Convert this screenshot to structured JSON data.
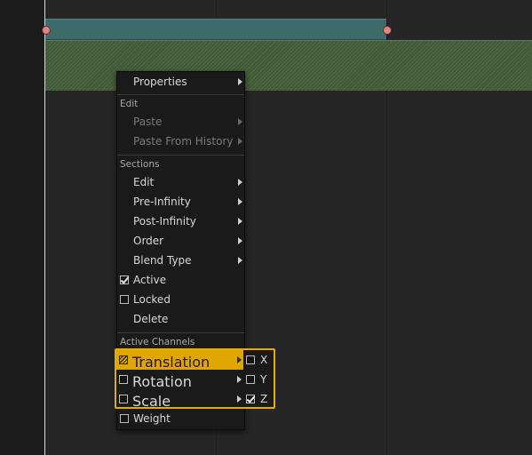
{
  "context_menu": {
    "properties_label": "Properties",
    "edit_header": "Edit",
    "paste_label": "Paste",
    "paste_history_label": "Paste From History",
    "sections_header": "Sections",
    "sections_items": [
      {
        "label": "Edit"
      },
      {
        "label": "Pre-Infinity"
      },
      {
        "label": "Post-Infinity"
      },
      {
        "label": "Order"
      },
      {
        "label": "Blend Type"
      }
    ],
    "active_label": "Active",
    "active_checked": true,
    "locked_label": "Locked",
    "locked_checked": false,
    "delete_label": "Delete",
    "channels_header": "Active Channels",
    "channels": [
      {
        "label": "Translation",
        "state": "partial",
        "selected": true
      },
      {
        "label": "Rotation",
        "state": "unchecked"
      },
      {
        "label": "Scale",
        "state": "unchecked"
      }
    ],
    "weight_label": "Weight",
    "weight_checked": false
  },
  "submenu": {
    "axes": [
      {
        "label": "X",
        "checked": false
      },
      {
        "label": "Y",
        "checked": false
      },
      {
        "label": "Z",
        "checked": true
      }
    ]
  },
  "colors": {
    "highlight": "#e0a500",
    "track_bar": "#3d6a6a",
    "hatch": "#4d6a43",
    "keyframe": "#e68383"
  }
}
